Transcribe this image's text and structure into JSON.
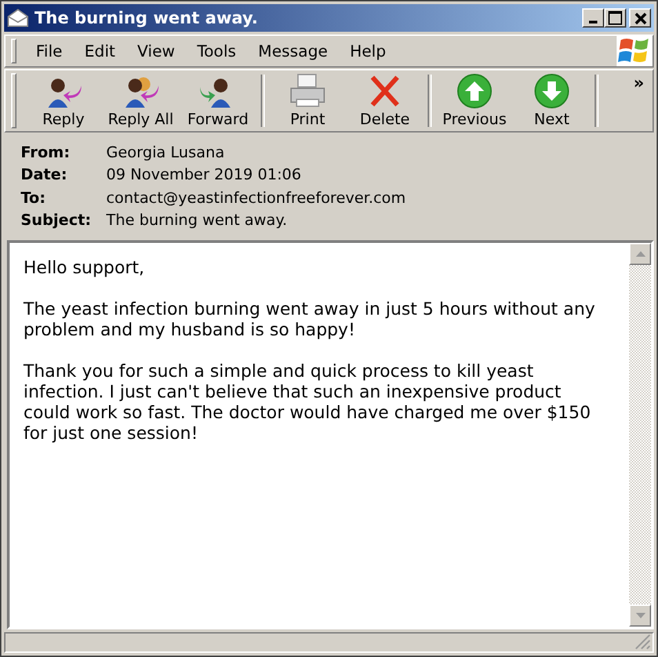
{
  "window": {
    "title": "The burning went away."
  },
  "menu": [
    "File",
    "Edit",
    "View",
    "Tools",
    "Message",
    "Help"
  ],
  "toolbar": [
    {
      "label": "Reply",
      "kind": "reply"
    },
    {
      "label": "Reply All",
      "kind": "replyall"
    },
    {
      "label": "Forward",
      "kind": "forward"
    },
    {
      "label": "Print",
      "kind": "print"
    },
    {
      "label": "Delete",
      "kind": "delete"
    },
    {
      "label": "Previous",
      "kind": "previous"
    },
    {
      "label": "Next",
      "kind": "next"
    }
  ],
  "toolbar_more": "»",
  "headers": [
    {
      "label": "From:",
      "value": "Georgia Lusana"
    },
    {
      "label": "Date:",
      "value": "09 November 2019 01:06"
    },
    {
      "label": "To:",
      "value": "contact@yeastinfectionfreeforever.com"
    },
    {
      "label": "Subject:",
      "value": "The burning went away."
    }
  ],
  "body": [
    "Hello support,",
    "The yeast infection burning went away in just 5 hours without any problem and my husband is so happy!",
    "Thank you for such a simple and quick process to kill yeast infection. I just can't believe that such an inexpensive product could work so fast. The doctor would have charged me over $150 for just one session!"
  ]
}
